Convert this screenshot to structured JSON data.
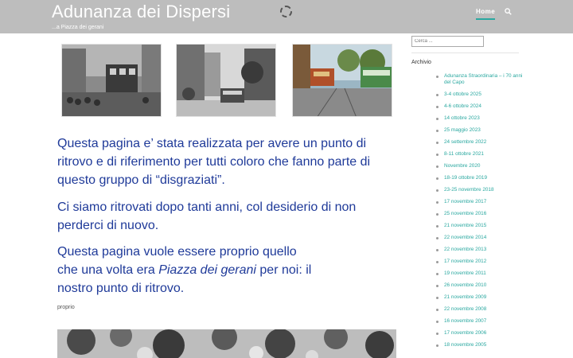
{
  "header": {
    "site_title": "Adunanza dei Dispersi",
    "tagline": "...a Piazza dei gerani",
    "nav_home": "Home"
  },
  "content": {
    "intro1": "Questa pagina e’ stata realizzata per avere un punto di ritrovo e di riferimento per tutti coloro che fanno parte di questo gruppo di “disgraziati”.",
    "intro2": "Ci siamo ritrovati dopo tanti anni, col desiderio di non perderci di nuovo.",
    "intro3_a": "Questa pagina vuole essere proprio quello che una volta era ",
    "intro3_em": "Piazza dei gerani",
    "intro3_b": " per noi: il nostro punto di ritrovo.",
    "post_label": "proprio"
  },
  "sidebar": {
    "search_placeholder": "Cerca ...",
    "archive_title": "Archivio",
    "archive_items": [
      "Adunanza Straordinaria – i 70 anni del Capo",
      "3-4 ottobre 2025",
      "4-6 ottobre 2024",
      "14 ottobre 2023",
      "25 maggio 2023",
      "24 settembre 2022",
      "8-11 ottobre 2021",
      "Novembre 2020",
      "18-19 ottobre 2019",
      "23-25 novembre 2018",
      "17 novembre 2017",
      "25 novembre 2016",
      "21 novembre 2015",
      "22 novembre 2014",
      "22 novembre 2013",
      "17 novembre 2012",
      "19 novembre 2011",
      "26 novembre 2010",
      "21 novembre 2009",
      "22 novembre 2008",
      "16 novembre 2007",
      "17 novembre 2006",
      "18 novembre 2005"
    ]
  },
  "colors": {
    "header_bg": "#bdbdbd",
    "text_blue": "#1f3a99",
    "link_teal": "#2aa8a0"
  }
}
